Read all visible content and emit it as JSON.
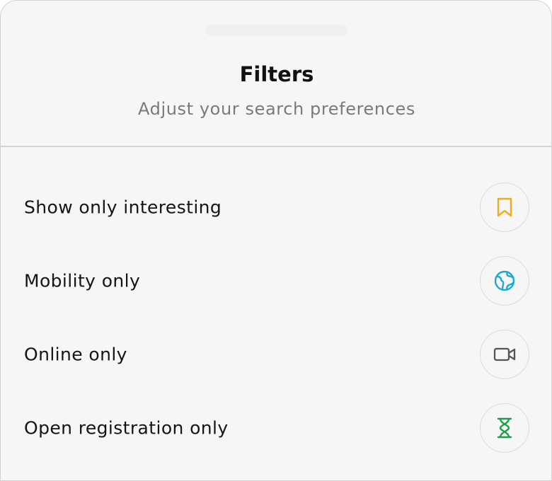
{
  "sheet": {
    "title": "Filters",
    "subtitle": "Adjust your search preferences"
  },
  "filters": [
    {
      "label": "Show only interesting",
      "icon": "bookmark-icon",
      "color": "#f0ab1c"
    },
    {
      "label": "Mobility only",
      "icon": "globe-icon",
      "color": "#1aa8d8"
    },
    {
      "label": "Online only",
      "icon": "video-camera-icon",
      "color": "#555555"
    },
    {
      "label": "Open registration only",
      "icon": "hourglass-icon",
      "color": "#1e9e4a"
    }
  ]
}
